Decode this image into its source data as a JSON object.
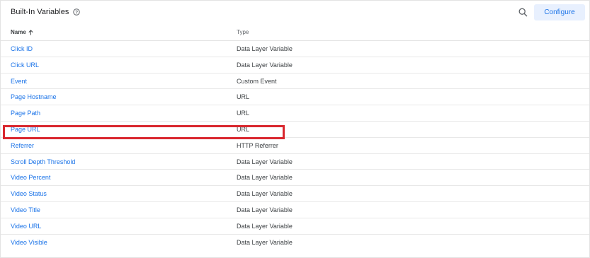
{
  "header": {
    "title": "Built-In Variables",
    "help_icon": "help-circle-icon",
    "search_icon": "search-icon",
    "configure_label": "Configure"
  },
  "columns": {
    "name": "Name",
    "name_sort_icon": "arrow-up-icon",
    "type": "Type"
  },
  "rows": [
    {
      "name": "Click ID",
      "type": "Data Layer Variable"
    },
    {
      "name": "Click URL",
      "type": "Data Layer Variable"
    },
    {
      "name": "Event",
      "type": "Custom Event"
    },
    {
      "name": "Page Hostname",
      "type": "URL"
    },
    {
      "name": "Page Path",
      "type": "URL"
    },
    {
      "name": "Page URL",
      "type": "URL"
    },
    {
      "name": "Referrer",
      "type": "HTTP Referrer"
    },
    {
      "name": "Scroll Depth Threshold",
      "type": "Data Layer Variable"
    },
    {
      "name": "Video Percent",
      "type": "Data Layer Variable"
    },
    {
      "name": "Video Status",
      "type": "Data Layer Variable"
    },
    {
      "name": "Video Title",
      "type": "Data Layer Variable"
    },
    {
      "name": "Video URL",
      "type": "Data Layer Variable"
    },
    {
      "name": "Video Visible",
      "type": "Data Layer Variable"
    }
  ],
  "colors": {
    "link": "#1a73e8",
    "highlight": "#d9272e",
    "configure_bg": "#e8f0fe"
  }
}
